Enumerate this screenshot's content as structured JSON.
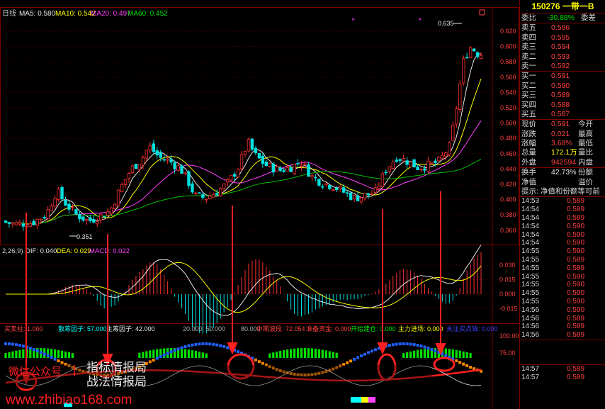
{
  "main_chart": {
    "period": "日线",
    "ma5_label": "MA5: 0.580",
    "ma10_label": "MA10: 0.542",
    "ma20_label": "MA20: 0.497",
    "ma60_label": "MA60: 0.452",
    "high_label": "0.635",
    "low_label": "0.351",
    "y_ticks": [
      "0.620",
      "0.600",
      "0.580",
      "0.560",
      "0.540",
      "0.520",
      "0.500",
      "0.480",
      "0.460",
      "0.440",
      "0.420",
      "0.400",
      "0.380",
      "0.360"
    ]
  },
  "macd": {
    "param": "2,26,9)",
    "dif": "DIF: 0.040",
    "dea": "DEA: 0.029",
    "macd": "MACD: 0.022",
    "y_ticks": [
      "0.030",
      "0.015",
      "0.000",
      "-0.015"
    ]
  },
  "indicator": {
    "labels": [
      "买卖柱: 1.000",
      "散筹因子: 57.000",
      "主筹因子: 42.000",
      "20.000: 50.000",
      "80.000",
      "中期波段: 72.054",
      "准备资金: 0.000",
      "开始建仓: 0.000",
      "主力进场: 0.000",
      "关注买点钱: 0.000"
    ],
    "y_ticks": [
      "100.00",
      "75.00"
    ]
  },
  "overlay": {
    "left_text": "微信公众号",
    "right_text": "指标情报局",
    "line2": "战法情报局",
    "url": "www.zhibiao168.com"
  },
  "panel": {
    "title": "150276 一带一B",
    "weibi_label": "委比",
    "weibi_value": "-30.88%",
    "weicha_label": "委差",
    "sells": [
      {
        "label": "卖五",
        "price": "0.596"
      },
      {
        "label": "卖四",
        "price": "0.595"
      },
      {
        "label": "卖三",
        "price": "0.594"
      },
      {
        "label": "卖二",
        "price": "0.593"
      },
      {
        "label": "卖一",
        "price": "0.592"
      }
    ],
    "buys": [
      {
        "label": "买一",
        "price": "0.591"
      },
      {
        "label": "买二",
        "price": "0.590"
      },
      {
        "label": "买三",
        "price": "0.589"
      },
      {
        "label": "买四",
        "price": "0.588"
      },
      {
        "label": "买五",
        "price": "0.587"
      }
    ],
    "stats": [
      {
        "l": "现价",
        "v": "0.591",
        "r": "今开",
        "c": "red"
      },
      {
        "l": "涨跌",
        "v": "0.021",
        "r": "最高",
        "c": "red"
      },
      {
        "l": "涨幅",
        "v": "3.68%",
        "r": "最低",
        "c": "red"
      },
      {
        "l": "总量",
        "v": "172.1万",
        "r": "量比",
        "c": "yel"
      },
      {
        "l": "外盘",
        "v": "942594",
        "r": "内盘",
        "c": "red"
      }
    ],
    "stats2": [
      {
        "l": "换手",
        "v": "42.73%",
        "r": "份额",
        "c": "wht"
      },
      {
        "l": "净值",
        "v": "",
        "r": "溢价",
        "c": "wht"
      }
    ],
    "tip": "提示: 净值和份额等可前",
    "ticks": [
      {
        "t": "14:53",
        "p": "0.589"
      },
      {
        "t": "14:54",
        "p": "0.589"
      },
      {
        "t": "14:54",
        "p": "0.589"
      },
      {
        "t": "14:54",
        "p": "0.590"
      },
      {
        "t": "14:54",
        "p": "0.590"
      },
      {
        "t": "14:54",
        "p": "0.590"
      },
      {
        "t": "14:55",
        "p": "0.590"
      },
      {
        "t": "14:55",
        "p": "0.589"
      },
      {
        "t": "14:55",
        "p": "0.589"
      },
      {
        "t": "14:55",
        "p": "0.590"
      },
      {
        "t": "14:55",
        "p": "0.590"
      },
      {
        "t": "14:55",
        "p": "0.590"
      },
      {
        "t": "14:55",
        "p": "0.590"
      },
      {
        "t": "14:56",
        "p": "0.590"
      },
      {
        "t": "14:56",
        "p": "0.589"
      },
      {
        "t": "14:56",
        "p": "0.589"
      },
      {
        "t": "14:56",
        "p": "0.589"
      }
    ],
    "ticks_bottom": [
      {
        "t": "14:57",
        "p": "0.589"
      },
      {
        "t": "14:57",
        "p": "0.589"
      }
    ]
  }
}
